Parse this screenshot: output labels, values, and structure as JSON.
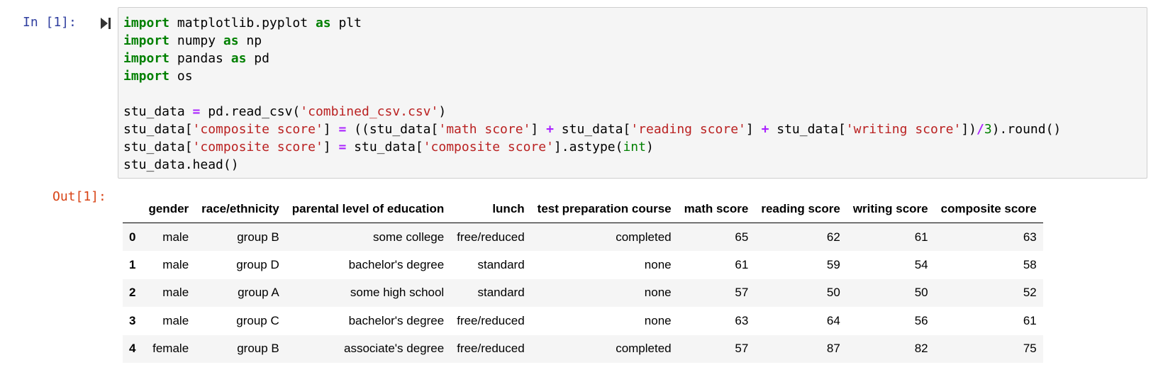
{
  "input_cell": {
    "prompt": "In [1]:",
    "lines": [
      [
        {
          "t": "import",
          "c": "kw"
        },
        {
          "t": " matplotlib.pyplot "
        },
        {
          "t": "as",
          "c": "kw"
        },
        {
          "t": " plt"
        }
      ],
      [
        {
          "t": "import",
          "c": "kw"
        },
        {
          "t": " numpy "
        },
        {
          "t": "as",
          "c": "kw"
        },
        {
          "t": " np"
        }
      ],
      [
        {
          "t": "import",
          "c": "kw"
        },
        {
          "t": " pandas "
        },
        {
          "t": "as",
          "c": "kw"
        },
        {
          "t": " pd"
        }
      ],
      [
        {
          "t": "import",
          "c": "kw"
        },
        {
          "t": " os"
        }
      ],
      [],
      [
        {
          "t": "stu_data "
        },
        {
          "t": "=",
          "c": "op"
        },
        {
          "t": " pd.read_csv("
        },
        {
          "t": "'combined_csv.csv'",
          "c": "str"
        },
        {
          "t": ")"
        }
      ],
      [
        {
          "t": "stu_data["
        },
        {
          "t": "'composite score'",
          "c": "str"
        },
        {
          "t": "] "
        },
        {
          "t": "=",
          "c": "op"
        },
        {
          "t": " ((stu_data["
        },
        {
          "t": "'math score'",
          "c": "str"
        },
        {
          "t": "] "
        },
        {
          "t": "+",
          "c": "op"
        },
        {
          "t": " stu_data["
        },
        {
          "t": "'reading score'",
          "c": "str"
        },
        {
          "t": "] "
        },
        {
          "t": "+",
          "c": "op"
        },
        {
          "t": " stu_data["
        },
        {
          "t": "'writing score'",
          "c": "str"
        },
        {
          "t": "])"
        },
        {
          "t": "/",
          "c": "op"
        },
        {
          "t": "3",
          "c": "num"
        },
        {
          "t": ").round()"
        }
      ],
      [
        {
          "t": "stu_data["
        },
        {
          "t": "'composite score'",
          "c": "str"
        },
        {
          "t": "] "
        },
        {
          "t": "=",
          "c": "op"
        },
        {
          "t": " stu_data["
        },
        {
          "t": "'composite score'",
          "c": "str"
        },
        {
          "t": "].astype("
        },
        {
          "t": "int",
          "c": "bi"
        },
        {
          "t": ")"
        }
      ],
      [
        {
          "t": "stu_data.head()"
        }
      ]
    ],
    "colors": {
      "keyword": "#008000",
      "operator": "#aa22ff",
      "string": "#ba2121",
      "number": "#008000",
      "in_prompt": "#303f9f",
      "out_prompt": "#d84315"
    },
    "run_icon": "step-forward-icon"
  },
  "output_cell": {
    "prompt": "Out[1]:",
    "table": {
      "columns": [
        "gender",
        "race/ethnicity",
        "parental level of education",
        "lunch",
        "test preparation course",
        "math score",
        "reading score",
        "writing score",
        "composite score"
      ],
      "index": [
        "0",
        "1",
        "2",
        "3",
        "4"
      ],
      "rows": [
        [
          "male",
          "group B",
          "some college",
          "free/reduced",
          "completed",
          "65",
          "62",
          "61",
          "63"
        ],
        [
          "male",
          "group D",
          "bachelor's degree",
          "standard",
          "none",
          "61",
          "59",
          "54",
          "58"
        ],
        [
          "male",
          "group A",
          "some high school",
          "standard",
          "none",
          "57",
          "50",
          "50",
          "52"
        ],
        [
          "male",
          "group C",
          "bachelor's degree",
          "free/reduced",
          "none",
          "63",
          "64",
          "56",
          "61"
        ],
        [
          "female",
          "group B",
          "associate's degree",
          "free/reduced",
          "completed",
          "57",
          "87",
          "82",
          "75"
        ]
      ]
    }
  }
}
